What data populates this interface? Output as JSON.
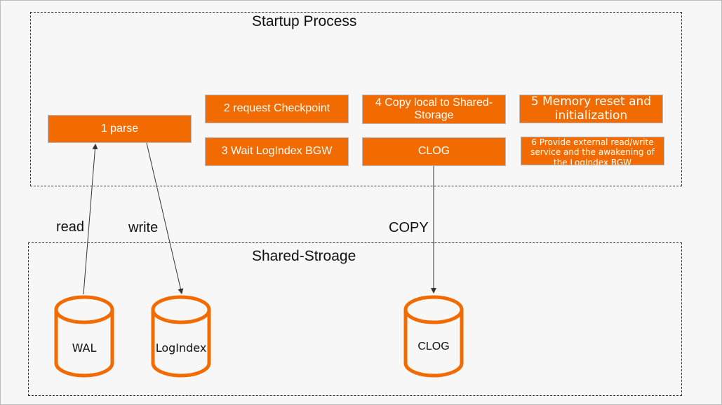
{
  "diagram": {
    "colors": {
      "step_fill": "#f26b00",
      "step_text": "#ffffff",
      "cylinder_stroke": "#f26b00",
      "line": "#333333",
      "background": "#f7f7f7"
    },
    "groups": {
      "startup": {
        "title": "Startup Process"
      },
      "storage": {
        "title": "Shared-Stroage"
      }
    },
    "steps": {
      "parse": "1 parse",
      "request_checkpoint": "2 request Checkpoint",
      "wait_logindex": "3 Wait LogIndex BGW",
      "copy_local": {
        "line1": "4 Copy local to Shared-",
        "line2": "Storage"
      },
      "clog": "CLOG",
      "memory_reset": {
        "line1": "5 Memory reset and",
        "line2": "initialization"
      },
      "provide_service": {
        "line1": "6 Provide external read/write",
        "line2": "service and the awakening of",
        "line3_prefix": "the ",
        "line3_word": "LogIndex",
        "line3_suffix": " BGW"
      }
    },
    "databases": {
      "wal": "WAL",
      "logindex": "LogIndex",
      "clog": "CLOG"
    },
    "edges": {
      "read": {
        "label": "read",
        "from": "WAL",
        "to": "1 parse"
      },
      "write": {
        "label": "write",
        "from": "1 parse",
        "to": "LogIndex"
      },
      "copy": {
        "label": "COPY",
        "from": "CLOG",
        "to": "CLOG (Shared-Stroage)"
      }
    }
  }
}
